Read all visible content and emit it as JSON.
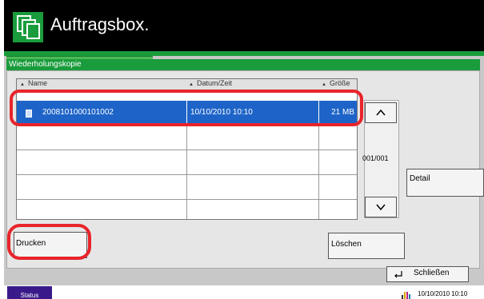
{
  "header": {
    "title": "Auftragsbox.",
    "icon": "copy-pages-icon"
  },
  "section": {
    "title": "Wiederholungskopie"
  },
  "table": {
    "columns": [
      "Name",
      "Datum/Zeit",
      "Größe"
    ],
    "rows": [
      {
        "name": "2008101000101002",
        "datetime": "10/10/2010  10:10",
        "size": "21 MB",
        "selected": true
      }
    ]
  },
  "pager": {
    "count": "001/001"
  },
  "buttons": {
    "detail": "Detail",
    "print": "Drucken",
    "delete": "Löschen",
    "close": "Schließen"
  },
  "status": {
    "label": "Status",
    "timestamp": "10/10/2010  10:10"
  },
  "colors": {
    "accent_green": "#1a9c3c",
    "selection_blue": "#1e64c8",
    "highlight_red": "#e8242a"
  }
}
